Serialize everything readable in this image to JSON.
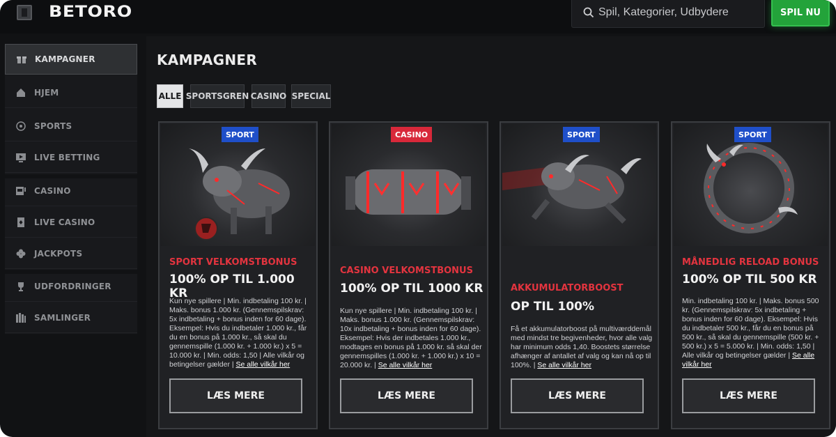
{
  "app": {
    "logo": "BETORO"
  },
  "header": {
    "search_placeholder": "Spil, Kategorier, Udbydere",
    "search_value": "",
    "play_label": "SPIL NU"
  },
  "sidebar": {
    "items": [
      {
        "label": "KAMPAGNER",
        "icon": "gift-icon"
      },
      {
        "label": "HJEM",
        "icon": "home-icon"
      },
      {
        "label": "SPORTS",
        "icon": "football-icon"
      },
      {
        "label": "LIVE BETTING",
        "icon": "live-tv-icon"
      },
      {
        "label": "CASINO",
        "icon": "slot-icon"
      },
      {
        "label": "LIVE CASINO",
        "icon": "cards-icon"
      },
      {
        "label": "JACKPOTS",
        "icon": "clover-icon"
      },
      {
        "label": "UDFORDRINGER",
        "icon": "trophy-icon"
      },
      {
        "label": "SAMLINGER",
        "icon": "collections-icon"
      }
    ]
  },
  "main": {
    "title": "KAMPAGNER",
    "filters": [
      {
        "label": "ALLE",
        "active": true
      },
      {
        "label": "SPORTSGREN",
        "active": false
      },
      {
        "label": "CASINO",
        "active": false
      },
      {
        "label": "SPECIAL",
        "active": false
      }
    ]
  },
  "cards": [
    {
      "tag": "SPORT",
      "title": "SPORT VELKOMSTBONUS",
      "headline": "100% OP TIL 1.000 KR",
      "desc": "Kun nye spillere | Min. indbetaling 100 kr. | Maks. bonus 1.000 kr. (Gennemspilskrav: 5x indbetaling + bonus inden for 60 dage). Eksempel: Hvis du indbetaler 1.000 kr., får du en bonus på 1.000 kr., så skal du gennemspille (1.000 kr. + 1.000 kr.) x 5 = 10.000 kr. | Min. odds: 1,50 | Alle vilkår og betingelser gælder |",
      "link": "Se alle vilkår her",
      "button": "LÆS MERE"
    },
    {
      "tag": "CASINO",
      "title": "CASINO VELKOMSTBONUS",
      "headline": "100% OP TIL  1000 KR",
      "desc": "Kun nye spillere | Min. indbetaling 100 kr. | Maks. bonus 1.000 kr. (Gennemspilskrav: 10x indbetaling + bonus inden for 60 dage). Eksempel: Hvis der indbetales 1.000 kr., modtages en bonus på 1.000 kr. så skal der gennemspilles (1.000 kr. + 1.000 kr.) x 10 = 20.000 kr. |",
      "link": "Se alle vilkår her",
      "button": "LÆS MERE"
    },
    {
      "tag": "SPORT",
      "title": "AKKUMULATORBOOST",
      "headline": "OP TIL 100%",
      "desc": "Få et akkumulatorboost på multiværddemål med mindst tre begivenheder, hvor alle valg har minimum odds 1,40. Boostets størrelse afhænger af antallet af valg og kan nå op til 100%. |",
      "link": "Se alle vilkår her",
      "button": "LÆS MERE"
    },
    {
      "tag": "SPORT",
      "title": "MÅNEDLIG RELOAD BONUS",
      "headline": "100% OP TIL 500 KR",
      "desc": "Min. indbetaling 100 kr. | Maks. bonus 500 kr. (Gennemspilskrav: 5x indbetaling + bonus inden for 60 dage). Eksempel: Hvis du indbetaler 500 kr., får du en bonus på 500 kr., så skal du gennemspille (500 kr. + 500 kr.) x 5 = 5.000 kr. | Min. odds: 1,50 | Alle vilkår og betingelser gælder |",
      "link": "Se alle vilkår her",
      "button": "LÆS MERE"
    }
  ],
  "colors": {
    "accent_red": "#e3343f",
    "sport_tag": "#1f4fc9",
    "casino_tag": "#d8283a",
    "play_green": "#23a33a"
  }
}
